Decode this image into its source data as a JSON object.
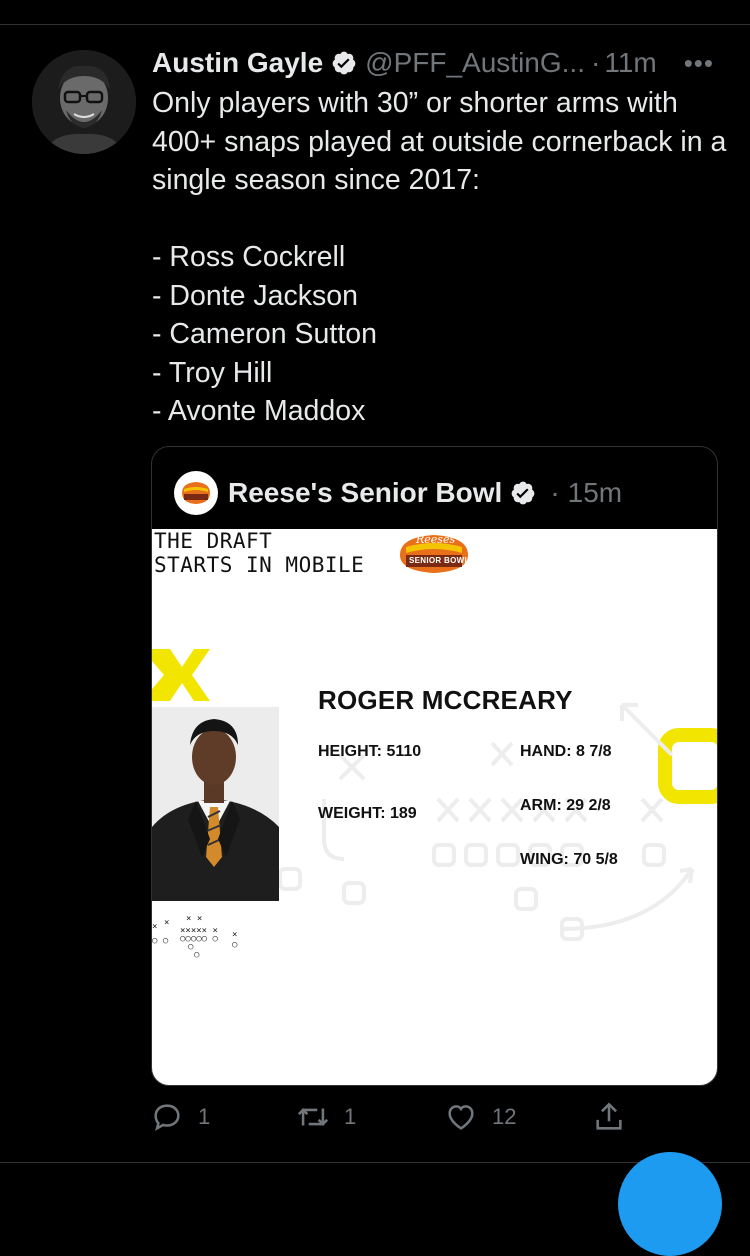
{
  "tweet": {
    "author_name": "Austin Gayle",
    "handle": "@PFF_AustinG...",
    "time": "11m",
    "more_label": "•••",
    "text_intro": "Only players with 30” or shorter arms with 400+ snaps played at outside cornerback in a single season since 2017:",
    "list": [
      "- Ross Cockrell",
      "- Donte Jackson",
      "- Cameron Sutton",
      "- Troy Hill",
      "- Avonte Maddox"
    ]
  },
  "quote": {
    "author_name": "Reese's Senior Bowl",
    "time": "15m",
    "logo_text": "Reeses",
    "logo_subtext": "SENIOR BOWL",
    "image": {
      "headline_line1": "THE DRAFT",
      "headline_line2": "STARTS IN MOBILE",
      "player_name": "ROGER MCCREARY",
      "height": "HEIGHT: 5110",
      "weight": "WEIGHT: 189",
      "hand": "HAND: 8 7/8",
      "arm": "ARM: 29 2/8",
      "wing": "WING: 70 5/8"
    }
  },
  "actions": {
    "replies": "1",
    "retweets": "1",
    "likes": "12"
  },
  "colors": {
    "background": "#000000",
    "text": "#e7e9ea",
    "muted": "#71767b",
    "accent": "#1d9bf0",
    "highlight_yellow": "#f2e600"
  },
  "icons": [
    "verified-icon",
    "reply-icon",
    "retweet-icon",
    "like-icon",
    "share-icon",
    "more-icon"
  ]
}
